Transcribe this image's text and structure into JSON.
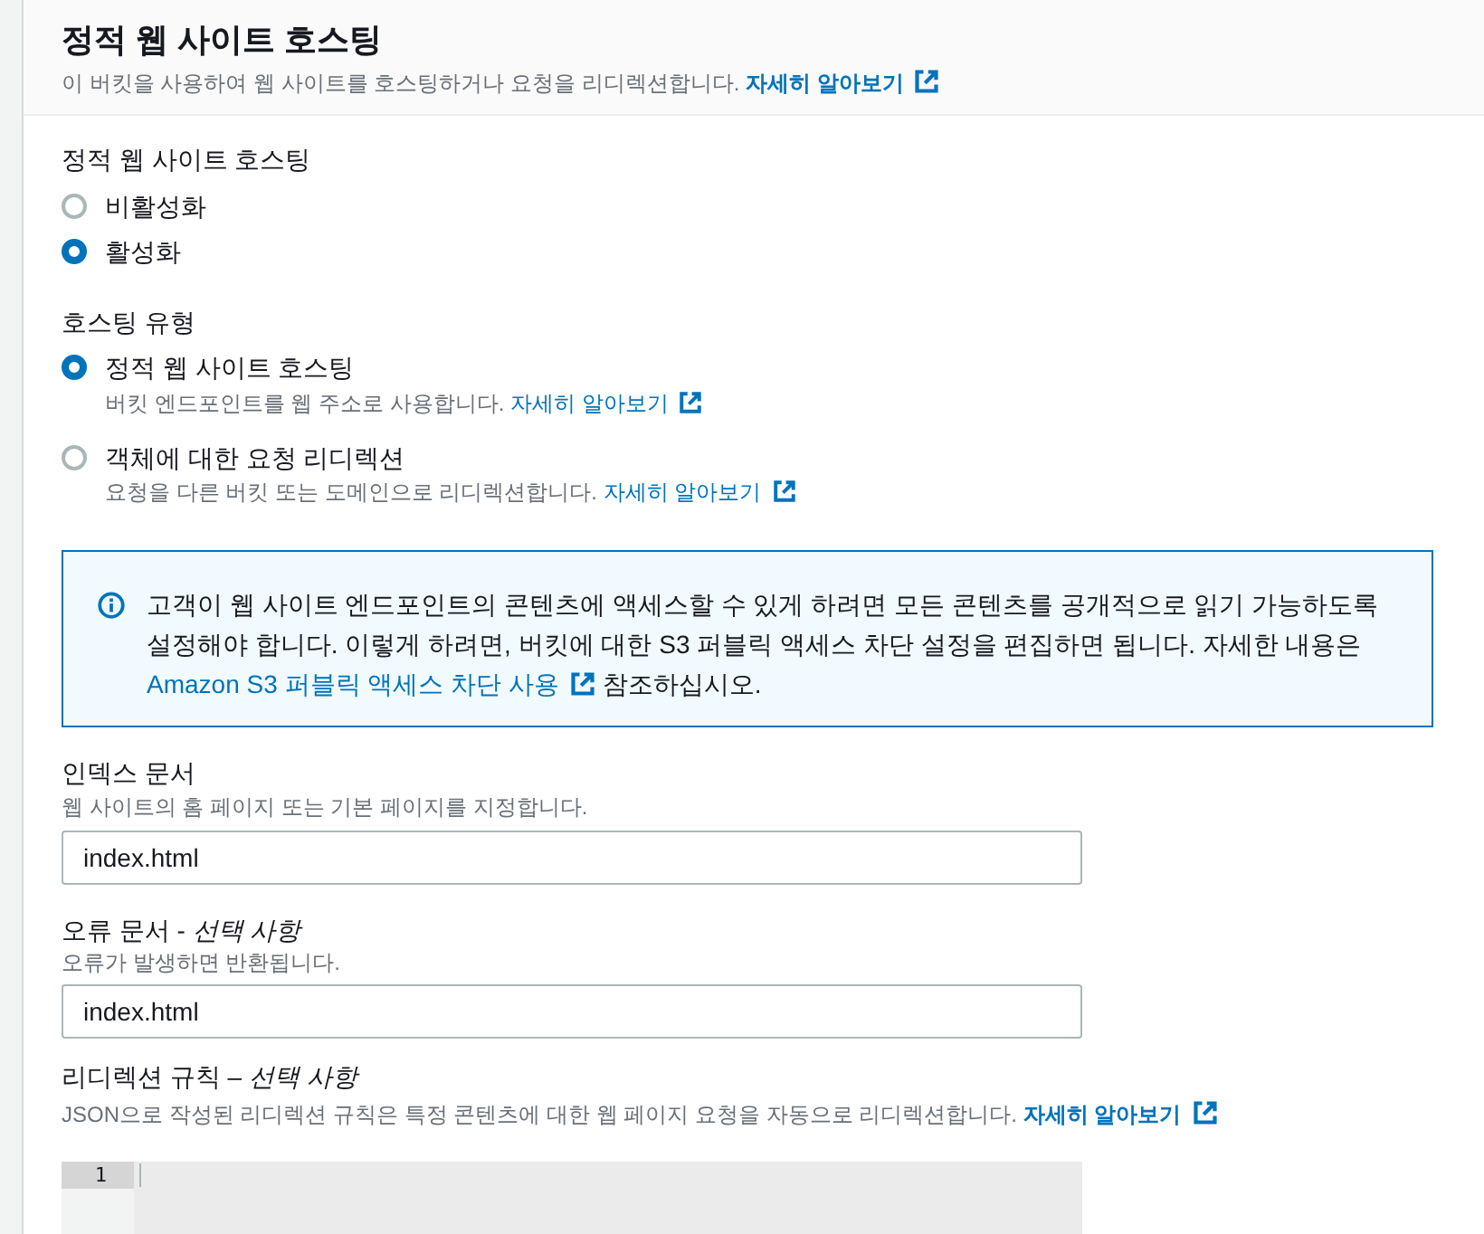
{
  "panel": {
    "title": "정적 웹 사이트 호스팅",
    "description": "이 버킷을 사용하여 웹 사이트를 호스팅하거나 요청을 리디렉션합니다.",
    "link": "자세히 알아보기"
  },
  "hosting_toggle": {
    "label": "정적 웹 사이트 호스팅",
    "options": [
      {
        "label": "비활성화",
        "selected": false
      },
      {
        "label": "활성화",
        "selected": true
      }
    ]
  },
  "hosting_type": {
    "label": "호스팅 유형",
    "options": [
      {
        "label": "정적 웹 사이트 호스팅",
        "description": "버킷 엔드포인트를 웹 주소로 사용합니다.",
        "link": "자세히 알아보기",
        "selected": true
      },
      {
        "label": "객체에 대한 요청 리디렉션",
        "description": "요청을 다른 버킷 또는 도메인으로 리디렉션합니다.",
        "link": "자세히 알아보기",
        "selected": false
      }
    ]
  },
  "info_alert": {
    "text": "고객이 웹 사이트 엔드포인트의 콘텐츠에 액세스할 수 있게 하려면 모든 콘텐츠를 공개적으로 읽기 가능하도록 설정해야 합니다. 이렇게 하려면, 버킷에 대한 S3 퍼블릭 액세스 차단 설정을 편집하면 됩니다. 자세한 내용은",
    "link": "Amazon S3 퍼블릭 액세스 차단 사용",
    "text_after": "참조하십시오."
  },
  "fields": [
    {
      "kind": "input",
      "label": "인덱스 문서",
      "description": "웹 사이트의 홈 페이지 또는 기본 페이지를 지정합니다.",
      "value": "index.html"
    },
    {
      "kind": "input",
      "label": "오류 문서 - *선택 사항*",
      "description": "오류가 발생하면 반환됩니다.",
      "value": "index.html"
    },
    {
      "kind": "code",
      "label": "리디렉션 규칙 – *선택 사항*",
      "description": "JSON으로 작성된 리디렉션 규칙은 특정 콘텐츠에 대한 웹 페이지 요청을 자동으로 리디렉션합니다.",
      "link": "자세히 알아보기",
      "line_numbers": [
        "1"
      ]
    }
  ]
}
